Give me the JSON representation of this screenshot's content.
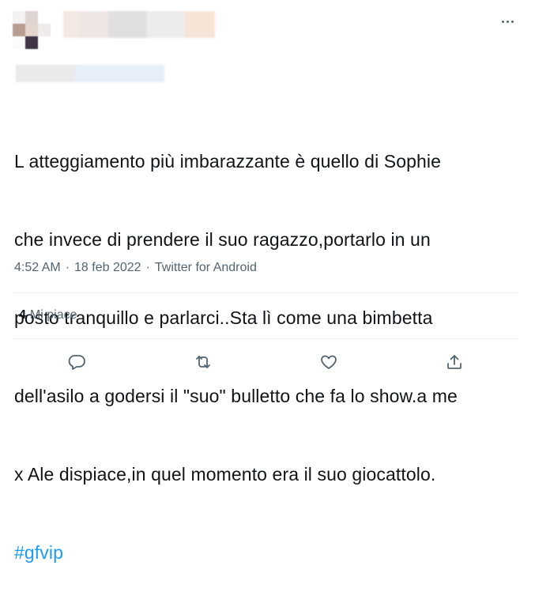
{
  "tweet": {
    "lines": [
      "L atteggiamento più imbarazzante è quello di Sophie",
      "che invece di prendere il suo ragazzo,portarlo in un",
      "posto tranquillo e parlarci..Sta lì come una bimbetta",
      "dell'asilo a godersi il \"suo\" bulletto che fa lo show.a me",
      "x Ale dispiace,in quel momento era il suo giocattolo."
    ],
    "hashtag": "#gfvip",
    "time": "4:52 AM",
    "separator1": "·",
    "date": "18 feb 2022",
    "separator2": "·",
    "source": "Twitter for Android"
  },
  "stats": {
    "likes_count": "4",
    "likes_label": "Mi piace"
  },
  "icons": {
    "more": "more-horizontal-icon",
    "reply": "reply-icon",
    "retweet": "retweet-icon",
    "like": "heart-icon",
    "share": "share-icon"
  },
  "colors": {
    "accent": "#1d9bf0",
    "secondary_text": "#536471",
    "text": "#0f1419",
    "divider": "#eff3f4"
  }
}
